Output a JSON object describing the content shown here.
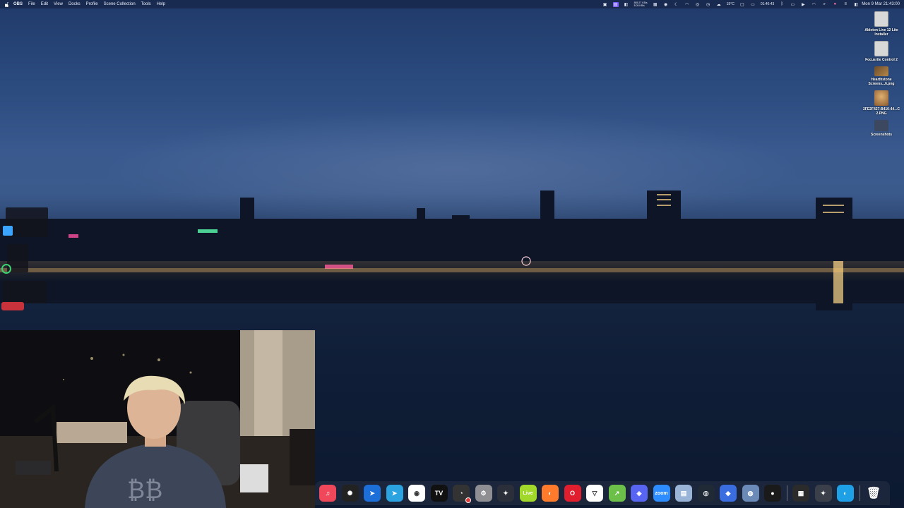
{
  "menubar": {
    "app_name": "OBS",
    "items": [
      "File",
      "Edit",
      "View",
      "Docks",
      "Profile",
      "Scene Collection",
      "Tools",
      "Help"
    ],
    "stats_top": "805.27 KB/s",
    "stats_bottom": "8.05 KB/s",
    "temperature": "19°C",
    "timer": "01:40:43",
    "clock": "Mon 9 Mar  21:43:00"
  },
  "status_icons": [
    "screen-record-icon",
    "obs-status-icon",
    "wifi-icon",
    "control-center-icon",
    "siri-icon"
  ],
  "desktop": [
    {
      "label": "Ableton Live 12 Lite Installer",
      "kind": "installer",
      "color": "#d8d8d8"
    },
    {
      "label": "Focusrite Control 2",
      "kind": "installer",
      "color": "#d8d8d8"
    },
    {
      "label": "Hearthstone Screens...6.png",
      "kind": "image",
      "color": "#7a5a3a"
    },
    {
      "label": "2FE2F427-B410-44...C 2.PNG",
      "kind": "image",
      "color": "#c08a50"
    },
    {
      "label": "Screenshots",
      "kind": "folder",
      "color": "#4c5a70"
    }
  ],
  "dock": [
    {
      "name": "music-icon",
      "label": "♫",
      "bg": "#f0475b"
    },
    {
      "name": "chatgpt-icon",
      "label": "✺",
      "bg": "#222"
    },
    {
      "name": "testflight-icon",
      "label": "➤",
      "bg": "#1c6fd8"
    },
    {
      "name": "telegram-icon",
      "label": "➤",
      "bg": "#2aa3e0"
    },
    {
      "name": "chrome-icon",
      "label": "◉",
      "bg": "#ffffff"
    },
    {
      "name": "tradingview-icon",
      "label": "TV",
      "bg": "#111"
    },
    {
      "name": "activity-monitor-icon",
      "label": "◔",
      "bg": "#333"
    },
    {
      "name": "system-settings-icon",
      "label": "⚙",
      "bg": "#8e8e93"
    },
    {
      "name": "davinci-resolve-icon",
      "label": "✦",
      "bg": "#2a2f3a"
    },
    {
      "name": "ableton-live-icon",
      "label": "Live",
      "bg": "#a2d82a"
    },
    {
      "name": "firefox-icon",
      "label": "◐",
      "bg": "#ff7a2a"
    },
    {
      "name": "opera-icon",
      "label": "O",
      "bg": "#e01e2e"
    },
    {
      "name": "proton-vpn-icon",
      "label": "▽",
      "bg": "#ffffff"
    },
    {
      "name": "xcode-cloud-icon",
      "label": "↗",
      "bg": "#6cc04a"
    },
    {
      "name": "discord-icon",
      "label": "◈",
      "bg": "#5865f2"
    },
    {
      "name": "zoom-icon",
      "label": "zoom",
      "bg": "#2d8cff"
    },
    {
      "name": "preview-icon",
      "label": "▤",
      "bg": "#9ab4d8"
    },
    {
      "name": "proton-icon",
      "label": "◎",
      "bg": "#1f2a36"
    },
    {
      "name": "bluetooth-app-icon",
      "label": "◆",
      "bg": "#3a6ee0"
    },
    {
      "name": "finder-disk-icon",
      "label": "◍",
      "bg": "#6b8ab8"
    },
    {
      "name": "obs-icon",
      "label": "●",
      "bg": "#1a1a1a"
    },
    {
      "name": "keyboard-icon",
      "label": "▦",
      "bg": "#2b2b2b"
    },
    {
      "name": "davinci-resolve-2-icon",
      "label": "✦",
      "bg": "#3a3f4a"
    },
    {
      "name": "cloud-app-icon",
      "label": "◐",
      "bg": "#1ea0e6"
    },
    {
      "name": "trash-icon",
      "label": "🗑",
      "bg": "transparent"
    }
  ]
}
